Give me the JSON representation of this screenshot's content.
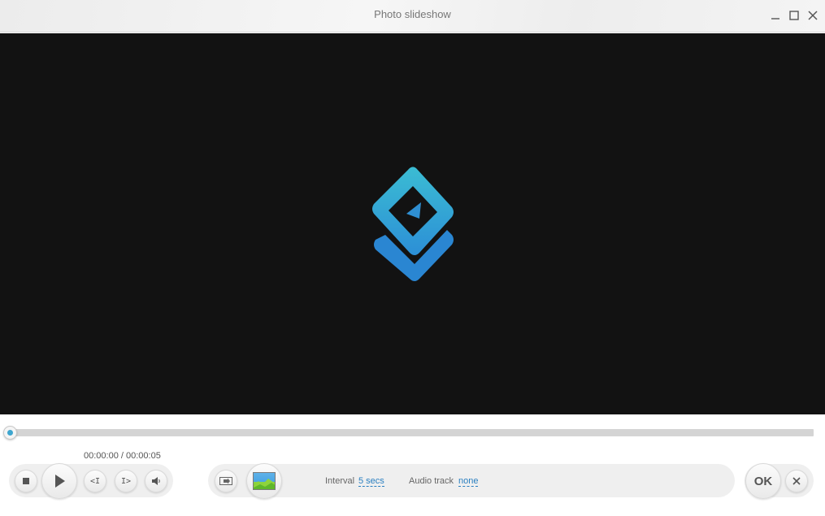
{
  "window": {
    "title": "Photo slideshow",
    "controls": [
      "minimize-icon",
      "maximize-icon",
      "close-icon"
    ]
  },
  "player": {
    "time_display": "00:00:00 / 00:00:05",
    "progress": 0,
    "controls": [
      "stop-icon",
      "play-icon",
      "prev-frame-icon",
      "next-frame-icon",
      "volume-icon"
    ],
    "prev_label": "<I",
    "next_label": "I>"
  },
  "slideshow": {
    "interval_label": "Interval",
    "interval_value": "5 secs",
    "audio_label": "Audio track",
    "audio_value": "none"
  },
  "actions": {
    "ok_label": "OK",
    "cancel_icon": "close-icon"
  },
  "colors": {
    "accent": "#3ea6cf",
    "video_bg": "#121212",
    "link": "#2a7fc0"
  }
}
